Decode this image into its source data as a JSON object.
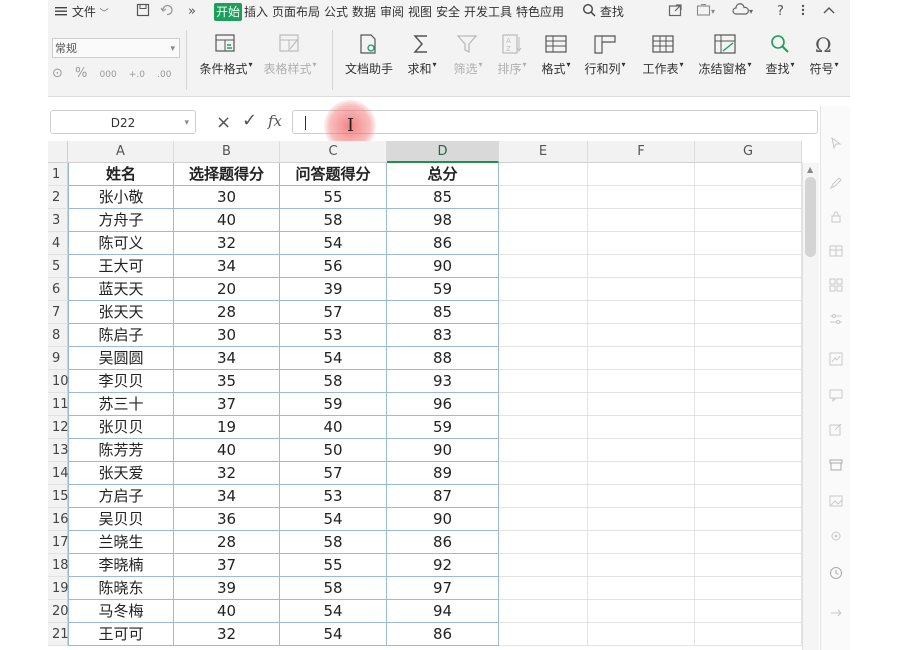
{
  "menubar": {
    "file_label": "文件",
    "tabs": [
      "开始",
      "插入",
      "页面布局",
      "公式",
      "数据",
      "审阅",
      "视图",
      "安全",
      "开发工具",
      "特色应用"
    ],
    "active_tab": "开始",
    "search_label": "查找"
  },
  "ribbon": {
    "number_format": "常规",
    "number_buttons": [
      "%",
      "000",
      "+.0",
      ".00"
    ],
    "buttons": [
      {
        "label": "条件格式",
        "icon": "conditional-format-icon",
        "caret": true,
        "disabled": false
      },
      {
        "label": "表格样式",
        "icon": "table-style-icon",
        "caret": true,
        "disabled": true
      },
      {
        "label": "文档助手",
        "icon": "doc-assistant-icon",
        "caret": false,
        "disabled": false
      },
      {
        "label": "求和",
        "icon": "sum-icon",
        "caret": true,
        "disabled": false
      },
      {
        "label": "筛选",
        "icon": "filter-icon",
        "caret": true,
        "disabled": true
      },
      {
        "label": "排序",
        "icon": "sort-icon",
        "caret": true,
        "disabled": true
      },
      {
        "label": "格式",
        "icon": "format-icon",
        "caret": true,
        "disabled": false
      },
      {
        "label": "行和列",
        "icon": "row-col-icon",
        "caret": true,
        "disabled": false
      },
      {
        "label": "工作表",
        "icon": "worksheet-icon",
        "caret": true,
        "disabled": false
      },
      {
        "label": "冻结窗格",
        "icon": "freeze-pane-icon",
        "caret": true,
        "disabled": false
      },
      {
        "label": "查找",
        "icon": "find-icon",
        "caret": true,
        "disabled": false
      },
      {
        "label": "符号",
        "icon": "symbol-icon",
        "caret": true,
        "disabled": false
      }
    ]
  },
  "formula_bar": {
    "name_box": "D22",
    "cancel_symbol": "×",
    "confirm_symbol": "✓",
    "fx_label": "fx",
    "value": ""
  },
  "sheet": {
    "columns": [
      "A",
      "B",
      "C",
      "D",
      "E",
      "F",
      "G"
    ],
    "selected_column": "D",
    "header": [
      "姓名",
      "选择题得分",
      "问答题得分",
      "总分"
    ],
    "rows": [
      [
        "张小敬",
        "30",
        "55",
        "85"
      ],
      [
        "方舟子",
        "40",
        "58",
        "98"
      ],
      [
        "陈可义",
        "32",
        "54",
        "86"
      ],
      [
        "王大可",
        "34",
        "56",
        "90"
      ],
      [
        "蓝天天",
        "20",
        "39",
        "59"
      ],
      [
        "张天天",
        "28",
        "57",
        "85"
      ],
      [
        "陈启子",
        "30",
        "53",
        "83"
      ],
      [
        "吴圆圆",
        "34",
        "54",
        "88"
      ],
      [
        "李贝贝",
        "35",
        "58",
        "93"
      ],
      [
        "苏三十",
        "37",
        "59",
        "96"
      ],
      [
        "张贝贝",
        "19",
        "40",
        "59"
      ],
      [
        "陈芳芳",
        "40",
        "50",
        "90"
      ],
      [
        "张天爱",
        "32",
        "57",
        "89"
      ],
      [
        "方启子",
        "34",
        "53",
        "87"
      ],
      [
        "吴贝贝",
        "36",
        "54",
        "90"
      ],
      [
        "兰晓生",
        "28",
        "58",
        "86"
      ],
      [
        "李晓楠",
        "37",
        "55",
        "92"
      ],
      [
        "陈晓东",
        "39",
        "58",
        "97"
      ],
      [
        "马冬梅",
        "40",
        "54",
        "94"
      ],
      [
        "王可可",
        "32",
        "54",
        "86"
      ]
    ]
  },
  "colors": {
    "accent_green": "#1aa05a",
    "table_border": "#9bbad3",
    "click_indicator": "#f05a5a"
  }
}
